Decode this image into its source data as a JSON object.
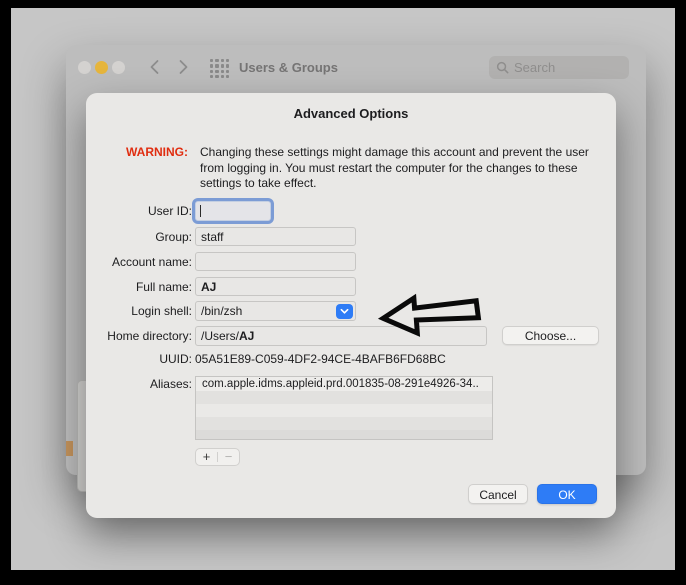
{
  "colors": {
    "accent-blue": "#2e7cf6",
    "warning-red": "#e02d10",
    "traffic-yellow": "#e6b53c"
  },
  "titlebar": {
    "title": "Users & Groups",
    "search_placeholder": "Search"
  },
  "dialog": {
    "title": "Advanced Options",
    "warning_label": "WARNING:",
    "warning_text": "Changing these settings might damage this account and prevent the user from logging in. You must restart the computer for the changes to these settings to take effect.",
    "fields": {
      "user_id": {
        "label": "User ID:",
        "value": ""
      },
      "group": {
        "label": "Group:",
        "value": "staff"
      },
      "account_name": {
        "label": "Account name:",
        "value": ""
      },
      "full_name": {
        "label": "Full name:",
        "value": "AJ"
      },
      "login_shell": {
        "label": "Login shell:",
        "value": "/bin/zsh"
      },
      "home_directory": {
        "label": "Home directory:",
        "value_prefix": "/Users/",
        "value_name": "AJ"
      }
    },
    "uuid": {
      "label": "UUID:",
      "value": "05A51E89-C059-4DF2-94CE-4BAFB6FD68BC"
    },
    "aliases": {
      "label": "Aliases:",
      "items": [
        "com.apple.idms.appleid.prd.001835-08-291e4926-34.."
      ]
    },
    "buttons": {
      "choose": "Choose...",
      "cancel": "Cancel",
      "ok": "OK",
      "add": "+",
      "remove": "−"
    }
  }
}
